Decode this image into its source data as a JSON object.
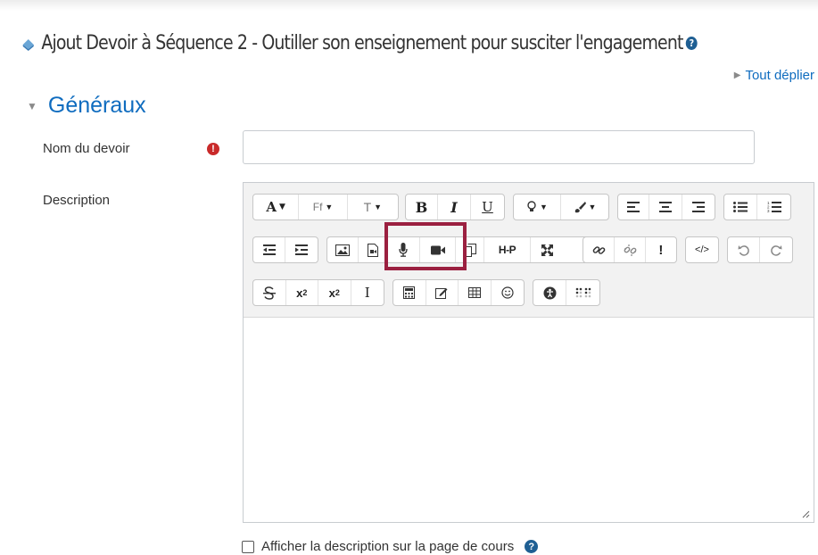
{
  "page": {
    "title": "Ajout Devoir à Séquence 2 - Outiller son enseignement pour susciter l'engagement",
    "help_symbol": "?",
    "expand_all": "Tout déplier"
  },
  "section": {
    "title": "Généraux"
  },
  "fields": {
    "name_label": "Nom du devoir",
    "name_value": "",
    "required_symbol": "!",
    "description_label": "Description"
  },
  "toolbar": {
    "font_label": "A",
    "font_family_label": "Ff",
    "font_size_label": "T",
    "bold_label": "B",
    "italic_label": "I",
    "underline_label": "U",
    "h5p_label": "H-P",
    "exclamation_label": "!",
    "html_label": "</>",
    "subscript_label": "x",
    "superscript_label": "x",
    "cursor_label": "I"
  },
  "checkbox": {
    "label": "Afficher la description sur la page de cours",
    "checked": false
  },
  "colors": {
    "link": "#0f6cbf",
    "highlight": "#9b2040",
    "required": "#c92a2a",
    "help": "#1f5f93"
  }
}
